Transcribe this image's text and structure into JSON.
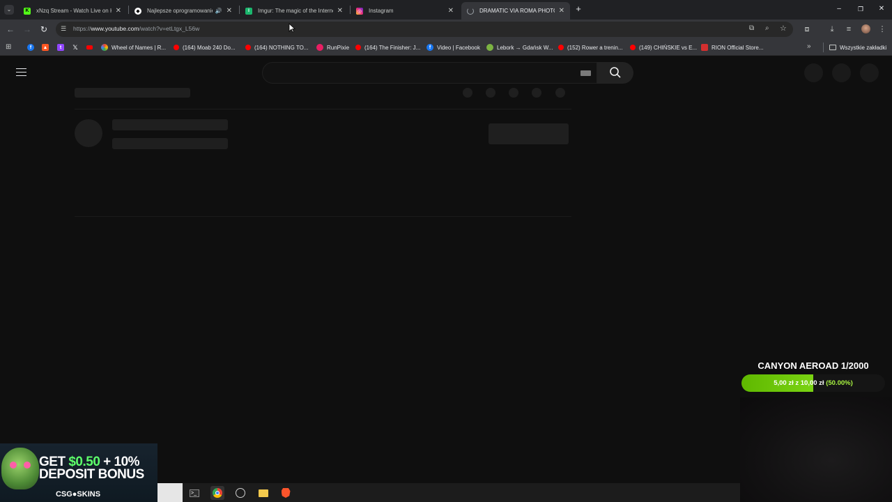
{
  "tabs": [
    {
      "title": "xNzq Stream - Watch Live on K",
      "icon": "kick-icon",
      "color": "#53fc18",
      "active": false
    },
    {
      "title": "Najlepsze oprogramowanie",
      "icon": "software-site-icon",
      "color": "#ffffff",
      "active": false,
      "audio": true
    },
    {
      "title": "Imgur: The magic of the Interne",
      "icon": "imgur-icon",
      "color": "#1bb76e",
      "active": false
    },
    {
      "title": "Instagram",
      "icon": "instagram-icon",
      "color": "#e1306c",
      "active": false
    },
    {
      "title": "DRAMATIC VIA ROMA PHOTO",
      "icon": "loading-icon",
      "color": "#9aa0a6",
      "active": true
    }
  ],
  "address_bar": {
    "url_prefix": "https://",
    "url_host": "www.youtube.com",
    "url_path": "/watch?v=etLtgx_L56w"
  },
  "bookmarks": [
    {
      "label": "",
      "icon": "facebook-icon",
      "color": "#1877f2"
    },
    {
      "label": "",
      "icon": "fire-icon",
      "color": "#ff5722"
    },
    {
      "label": "",
      "icon": "twitch-icon",
      "color": "#9146ff"
    },
    {
      "label": "",
      "icon": "x-icon",
      "color": "#e8eaed"
    },
    {
      "label": "",
      "icon": "youtube-icon",
      "color": "#ff0000"
    },
    {
      "label": "Wheel of Names | R...",
      "icon": "wheel-icon",
      "color": "#34a853"
    },
    {
      "label": "(164) Moab 240 Do...",
      "icon": "youtube-icon",
      "color": "#ff0000"
    },
    {
      "label": "(164) NOTHING TO...",
      "icon": "youtube-icon",
      "color": "#ff0000"
    },
    {
      "label": "RunPixie",
      "icon": "runpixie-icon",
      "color": "#e91e63"
    },
    {
      "label": "(164) The Finisher: J...",
      "icon": "youtube-icon",
      "color": "#ff0000"
    },
    {
      "label": "Video | Facebook",
      "icon": "facebook-icon",
      "color": "#1877f2"
    },
    {
      "label": "Lebork → Gdańsk W...",
      "icon": "maps-icon",
      "color": "#7cb342"
    },
    {
      "label": "(152) Rower a trenin...",
      "icon": "youtube-icon",
      "color": "#ff0000"
    },
    {
      "label": "(149) CHIŃSKIE vs E...",
      "icon": "youtube-icon",
      "color": "#ff0000"
    },
    {
      "label": "RION Official Store...",
      "icon": "rion-icon",
      "color": "#d32f2f"
    }
  ],
  "all_bookmarks_label": "Wszystkie zakładki",
  "goal": {
    "title": "CANYON AEROAD 1/2000",
    "current": "5,00 zł",
    "separator": "z",
    "target": "10,00 zł",
    "percent_text": "(50.00%)",
    "progress": 0.5
  },
  "ad": {
    "line1_prefix": "GET ",
    "line1_amount": "$0.50",
    "line1_suffix": " + 10%",
    "line2": "DEPOSIT BONUS",
    "brand": "CSG●SKINS"
  },
  "taskbar_apps": [
    "terminal-icon",
    "chrome-icon",
    "app-icon",
    "file-explorer-icon",
    "brave-icon"
  ]
}
